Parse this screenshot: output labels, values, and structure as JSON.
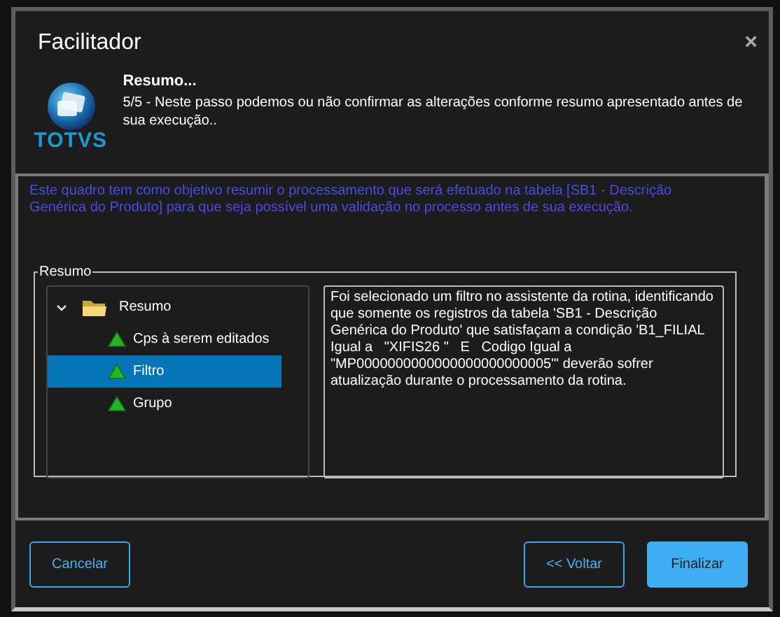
{
  "window": {
    "title": "Facilitador",
    "close": "×"
  },
  "header": {
    "logo_text": "TOTVS",
    "title": "Resumo...",
    "description": "5/5 - Neste passo podemos ou não confirmar as alterações conforme resumo apresentado antes de sua execução.."
  },
  "info": "Este quadro tem como objetivo resumir o processamento que será efetuado na tabela [SB1 - Descrição Genérica do Produto] para que seja possível uma validação no processo antes de sua execução.",
  "group": {
    "label": "Resumo",
    "tree": [
      {
        "label": "Resumo",
        "expanded": true,
        "selected": false,
        "children": [
          {
            "label": "Cps à serem editados",
            "selected": false
          },
          {
            "label": "Filtro",
            "selected": true
          },
          {
            "label": "Grupo",
            "selected": false
          }
        ]
      }
    ],
    "detail": "Foi selecionado um filtro no assistente da rotina, identificando que somente os registros da tabela 'SB1 - Descrição Genérica do Produto' que satisfaçam a condição 'B1_FILIAL Igual a   \"XIFIS26 \"   E   Codigo Igual a \"MP0000000000000000000000005\"' deverão sofrer atualização durante o processamento da rotina."
  },
  "buttons": [
    {
      "label": "Cancelar",
      "kind": "outline"
    },
    {
      "label": "<< Voltar",
      "kind": "outline"
    },
    {
      "label": "Finalizar",
      "kind": "primary"
    }
  ]
}
